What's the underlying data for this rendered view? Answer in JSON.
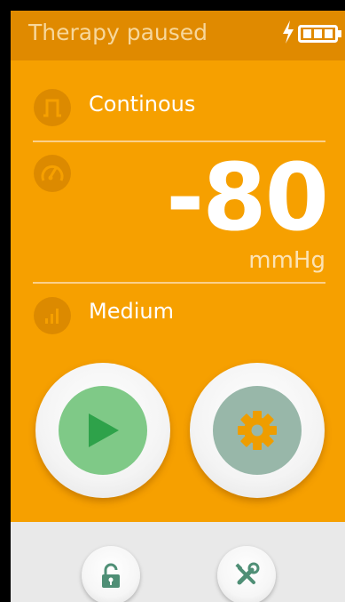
{
  "status": {
    "title": "Therapy paused",
    "charging_icon": "bolt-icon",
    "battery_icon": "battery-icon"
  },
  "mode": {
    "icon": "square-wave-icon",
    "label": "Continous"
  },
  "pressure": {
    "icon": "gauge-icon",
    "value": "-80",
    "unit": "mmHg"
  },
  "level": {
    "icon": "signal-bars-icon",
    "label": "Medium"
  },
  "controls": {
    "play_icon": "play-icon",
    "settings_icon": "gear-icon"
  },
  "bottom": {
    "lock_icon": "unlock-icon",
    "tools_icon": "tools-icon"
  },
  "colors": {
    "background": "#F6A000",
    "status_bar": "#E08A00",
    "play_green": "#7FC987",
    "settings_grey_green": "#98B7A9",
    "bottom_bar": "#E9E9E9"
  }
}
